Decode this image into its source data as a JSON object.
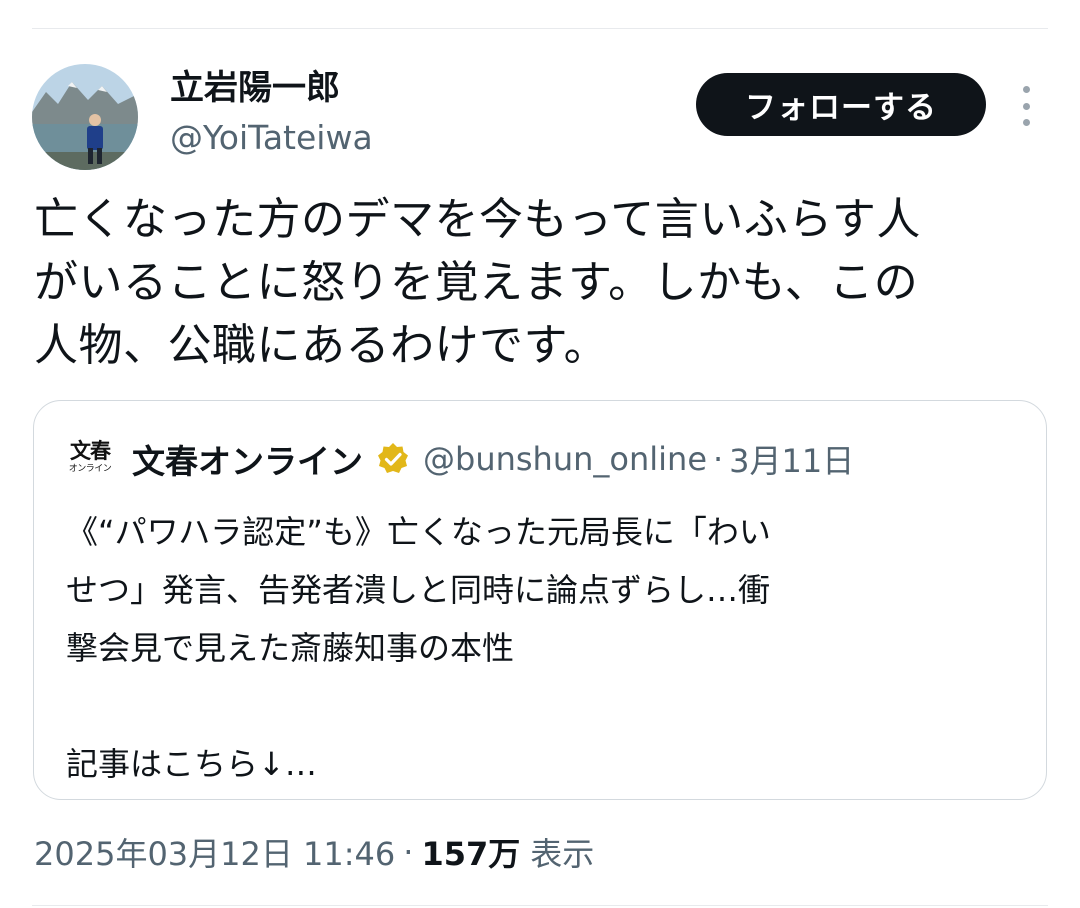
{
  "header": {
    "display_name": "立岩陽一郎",
    "handle": "@YoiTateiwa",
    "follow_label": "フォローする",
    "avatar_icon": "avatar-photo",
    "more_icon": "more-vertical-icon"
  },
  "tweet": {
    "text": "亡くなった方のデマを今もって言いふらす人\nがいることに怒りを覚えます。しかも、この\n人物、公職にあるわけです。"
  },
  "quote": {
    "logo_big": "文春",
    "logo_small": "オンライン",
    "name": "文春オンライン",
    "verified_color": "#e2b719",
    "handle": "@bunshun_online",
    "separator": "·",
    "date": "3月11日",
    "text": "《“パワハラ認定”も》亡くなった元局長に「わい\nせつ」発言、告発者潰しと同時に論点ずらし…衝\n撃会見で見えた斎藤知事の本性\n\n記事はこちら↓…"
  },
  "meta": {
    "timestamp": "2025年03月12日 11:46",
    "separator": "·",
    "views_count": "157万",
    "views_label": "表示"
  }
}
